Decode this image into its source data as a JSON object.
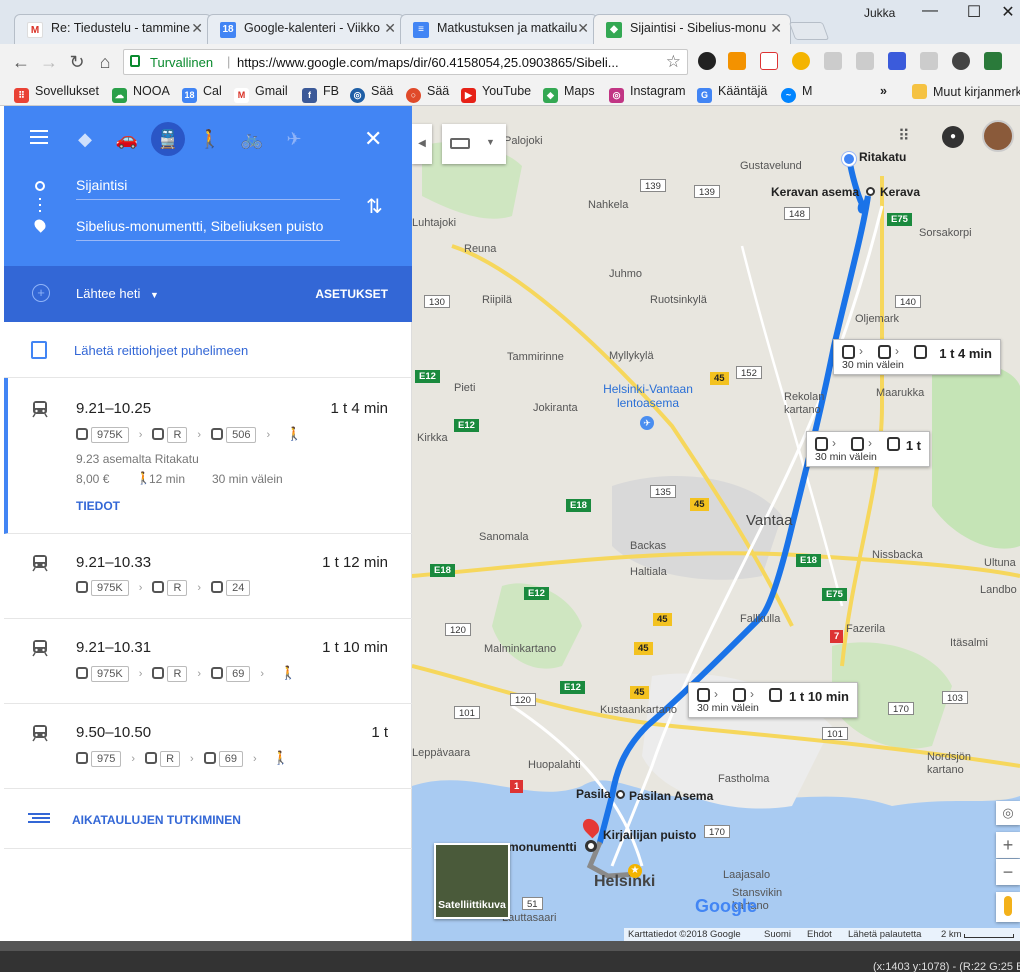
{
  "window": {
    "user": "Jukka",
    "minimize": "—",
    "maximize": "☐",
    "close": "✕"
  },
  "tabs": [
    {
      "label": "Re: Tiedustelu - tammine",
      "icon": "gmail-icon",
      "fav": "M",
      "color": "#ffffff",
      "fg": "#d93025"
    },
    {
      "label": "Google-kalenteri - Viikko",
      "icon": "calendar-icon",
      "fav": "18",
      "color": "#4285f4",
      "fg": "#ffffff"
    },
    {
      "label": "Matkustuksen ja matkailu",
      "icon": "docs-icon",
      "fav": "≡",
      "color": "#4285f4",
      "fg": "#ffffff"
    },
    {
      "label": "Sijaintisi - Sibelius-monu",
      "icon": "maps-icon",
      "fav": "",
      "color": "#34a853",
      "fg": "#ffffff"
    }
  ],
  "omnibox": {
    "secure": "Turvallinen",
    "url": "https://www.google.com/maps/dir/60.4158054,25.0903865/Sibeli..."
  },
  "bookmarks": [
    {
      "label": "Sovellukset",
      "color": "#e94235",
      "fav": "⠿"
    },
    {
      "label": "NOOA",
      "color": "#2aa04a",
      "fav": "☁"
    },
    {
      "label": "Cal",
      "color": "#4285f4",
      "fav": "18"
    },
    {
      "label": "Gmail",
      "color": "#ffffff",
      "fav": "M"
    },
    {
      "label": "FB",
      "color": "#3b5998",
      "fav": "f"
    },
    {
      "label": "Sää",
      "color": "#1f5fa6",
      "fav": "◎"
    },
    {
      "label": "Sää",
      "color": "#e04a2a",
      "fav": "○"
    },
    {
      "label": "YouTube",
      "color": "#e62117",
      "fav": "▶"
    },
    {
      "label": "Maps",
      "color": "#34a853",
      "fav": "◆"
    },
    {
      "label": "Instagram",
      "color": "#c13584",
      "fav": "◎"
    },
    {
      "label": "Kääntäjä",
      "color": "#4285f4",
      "fav": "G"
    },
    {
      "label": "M",
      "color": "#0084ff",
      "fav": "~"
    }
  ],
  "bookmarks_more": "»",
  "bookmarks_other": "Muut kirjanmerk",
  "panel": {
    "origin": "Sijaintisi",
    "destination": "Sibelius-monumentti, Sibeliuksen puisto",
    "depart": "Lähtee heti",
    "options": "ASETUKSET",
    "send_to_phone": "Lähetä reittiohjeet puhelimeen",
    "explore": "AIKATAULUJEN TUTKIMINEN",
    "details": "TIEDOT"
  },
  "routes": [
    {
      "time": "9.21–10.25",
      "duration": "1 t 4 min",
      "lines": [
        "975K",
        "R",
        "506"
      ],
      "walk_end": true,
      "from": "9.23 asemalta Ritakatu",
      "price": "8,00 €",
      "walk": "12 min",
      "freq": "30 min välein"
    },
    {
      "time": "9.21–10.33",
      "duration": "1 t 12 min",
      "lines": [
        "975K",
        "R",
        "24"
      ],
      "walk_end": false
    },
    {
      "time": "9.21–10.31",
      "duration": "1 t 10 min",
      "lines": [
        "975K",
        "R",
        "69"
      ],
      "walk_end": true
    },
    {
      "time": "9.50–10.50",
      "duration": "1 t",
      "lines": [
        "975",
        "R",
        "69"
      ],
      "walk_end": true
    }
  ],
  "map": {
    "places": [
      "Palojoki",
      "Gustavelund",
      "Nahkela",
      "Luhtajoki",
      "Reuna",
      "Juhmo",
      "Riipilä",
      "Ruotsinkylä",
      "Oljemark",
      "Sorsakorpi",
      "Tammirinne",
      "Myllykylä",
      "Pieti",
      "Jokiranta",
      "Maarukka",
      "Kirkka",
      "Sanomala",
      "Backas",
      "Haltiala",
      "Nissbacka",
      "Ultuna",
      "Landbo",
      "Fazerila",
      "Itäsalmi",
      "Malminkartano",
      "Fallkulla",
      "Kustaankartano",
      "Leppävaara",
      "Huopalahti",
      "Fastholma",
      "Nordsjön kartano",
      "Laajasalo",
      "Stansvikin kartano",
      "Lauttasaari"
    ],
    "airport": "Helsinki-Vantaan lentoasema",
    "rekola": "Rekolan kartano",
    "cities": [
      "Vantaa",
      "Helsinki"
    ],
    "stops": {
      "ritakatu": "Ritakatu",
      "keravan_asema": "Keravan asema",
      "kerava": "Kerava",
      "pasila": "Pasila",
      "pasilan_asema": "Pasilan Asema",
      "monumentti": "monumentti",
      "kirjailijan_puisto": "Kirjailijan puisto"
    },
    "callouts": [
      {
        "dur": "1 t 4 min",
        "freq": "30 min välein"
      },
      {
        "dur": "1 t",
        "freq": "30 min välein"
      },
      {
        "dur": "1 t 10 min",
        "freq": "30 min välein"
      }
    ],
    "satellite": "Satelliittikuva",
    "footer": [
      "Karttatiedot ©2018 Google",
      "Suomi",
      "Ehdot",
      "Lähetä palautetta",
      "2 km"
    ],
    "google": "Google",
    "shields": {
      "r139a": "139",
      "r139b": "139",
      "r148": "148",
      "e75a": "E75",
      "r130": "130",
      "r140": "140",
      "r152": "152",
      "r45a": "45",
      "e12a": "E12",
      "e12b": "E12",
      "r135": "135",
      "r45b": "45",
      "e18a": "E18",
      "e18b": "E18",
      "e18c": "E18",
      "e12c": "E12",
      "e75b": "E75",
      "r7": "7",
      "r120": "120",
      "r45c": "45",
      "r45d": "45",
      "e12d": "E12",
      "r120b": "120",
      "r101a": "101",
      "r101b": "101",
      "r103": "103",
      "r170a": "170",
      "r170b": "170",
      "r1": "1",
      "r51": "51"
    }
  },
  "statusbar": "(x:1403 y:1078) - (R:22 G:25 B"
}
